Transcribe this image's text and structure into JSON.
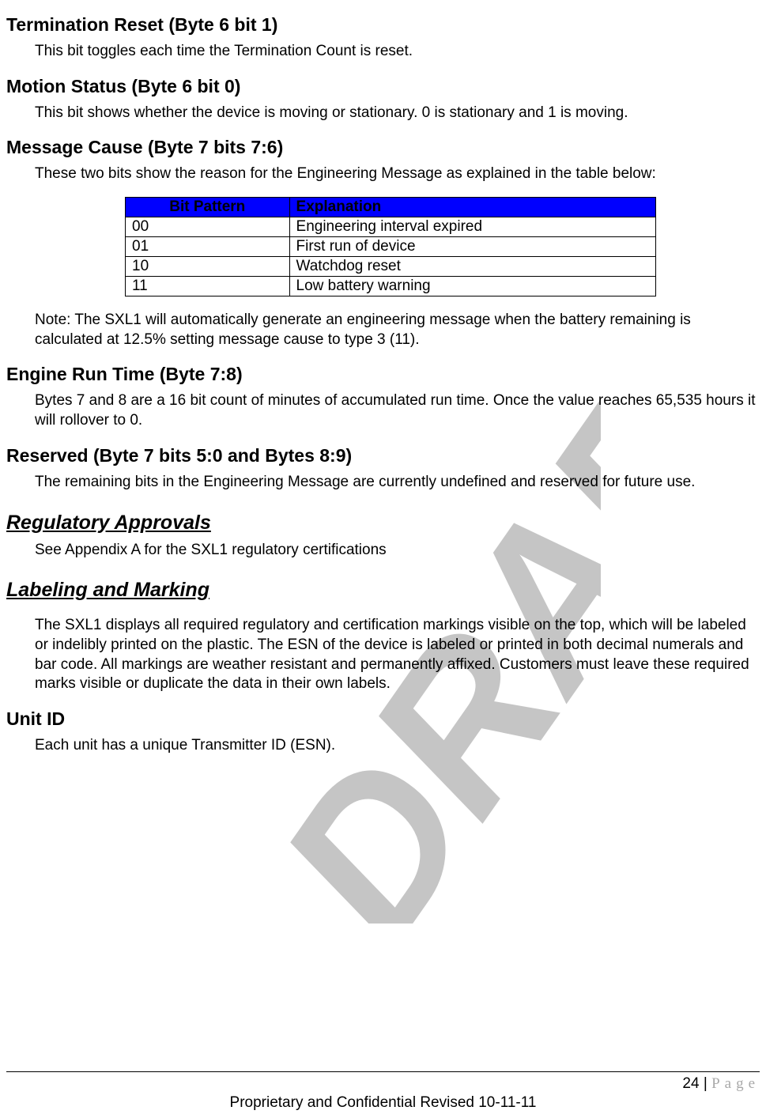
{
  "sections": {
    "s1": {
      "title": "Termination Reset (Byte 6 bit 1)",
      "body": "This bit toggles each time the Termination Count is reset."
    },
    "s2": {
      "title": "Motion Status (Byte 6 bit 0)",
      "body": "This bit shows whether the device is moving or stationary.  0 is stationary and 1 is moving."
    },
    "s3": {
      "title": "Message Cause (Byte 7 bits 7:6)",
      "body": "These two bits show the reason for the Engineering Message as explained in the table below:"
    },
    "s4": {
      "title": "Engine Run Time (Byte 7:8)",
      "body": "Bytes 7 and 8 are a 16 bit count of minutes of accumulated run time.  Once the value reaches 65,535 hours it will rollover to 0."
    },
    "s5": {
      "title": "Reserved (Byte 7 bits 5:0 and Bytes 8:9)",
      "body": "The remaining bits in the Engineering Message are currently undefined and reserved for future use."
    },
    "s6": {
      "title": "Regulatory Approvals",
      "body": "See Appendix A for the SXL1 regulatory certifications"
    },
    "s7": {
      "title": "Labeling and Marking",
      "body": "The SXL1 displays all required regulatory and certification markings visible on the top, which will be labeled or indelibly printed on the plastic.  The ESN of the device is labeled or printed in both decimal numerals and bar code.  All markings are weather resistant and permanently affixed.  Customers must leave these required marks visible or duplicate the data in their own labels."
    },
    "s8": {
      "title": "Unit ID",
      "body": "Each unit has a unique Transmitter ID (ESN)."
    }
  },
  "table": {
    "headers": {
      "col1": "Bit Pattern",
      "col2": "Explanation"
    },
    "rows": [
      {
        "c1": "00",
        "c2": "Engineering interval expired"
      },
      {
        "c1": "01",
        "c2": "First run of device"
      },
      {
        "c1": "10",
        "c2": "Watchdog reset"
      },
      {
        "c1": "11",
        "c2": "Low battery warning"
      }
    ]
  },
  "note": "Note:  The SXL1 will automatically generate an engineering message when the battery remaining is calculated at 12.5% setting message cause to type 3 (11).",
  "footer": {
    "pageNum": "24",
    "pageSep": " | ",
    "pageLabel": "Page",
    "line": "Proprietary and Confidential Revised 10-11-11"
  },
  "watermark": "DRAFT"
}
